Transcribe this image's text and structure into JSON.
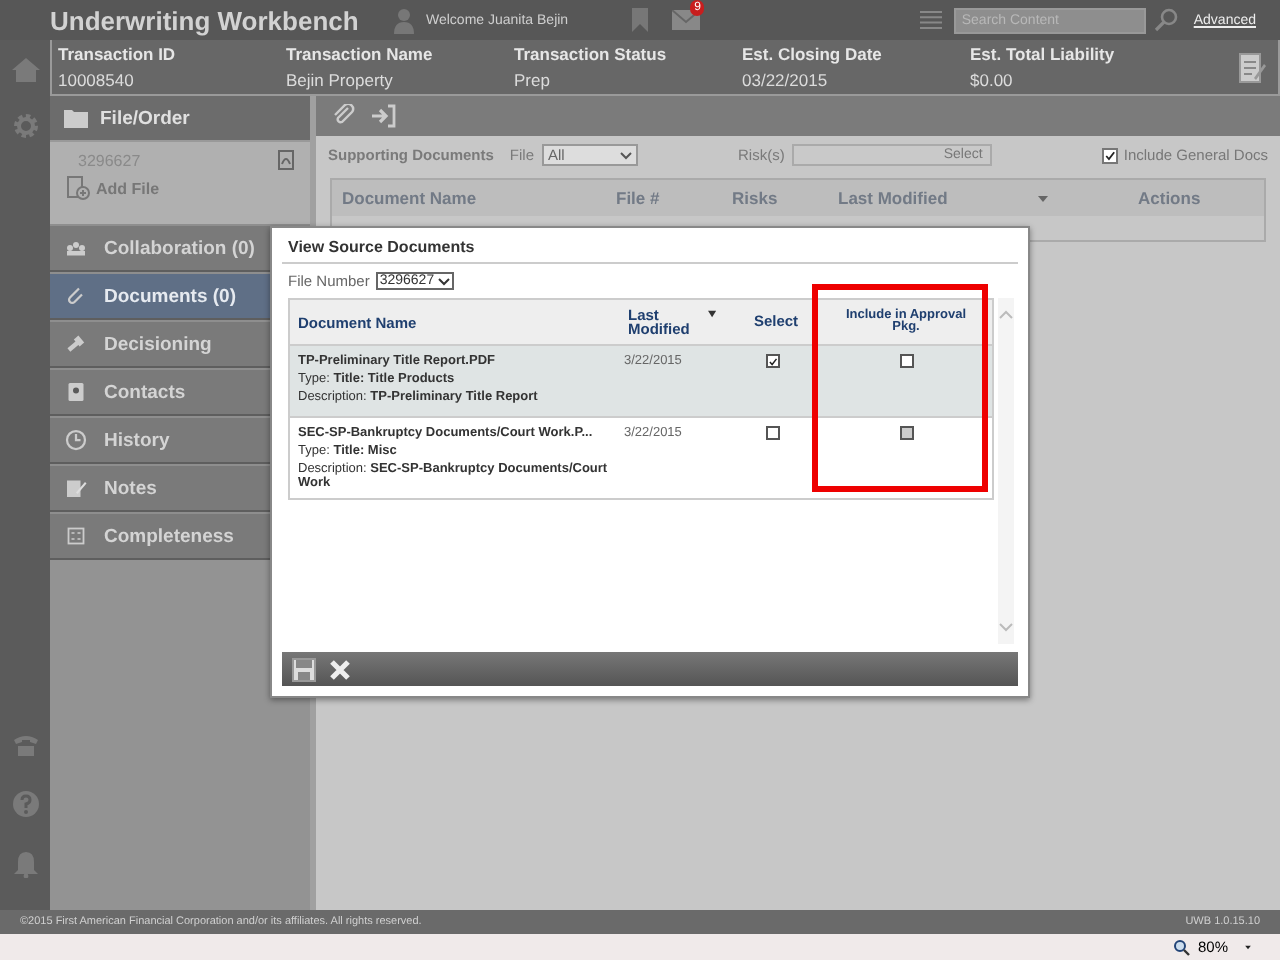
{
  "header": {
    "title": "Underwriting Workbench",
    "welcome": "Welcome Juanita Bejin",
    "mail_badge": "9",
    "search_placeholder": "Search Content",
    "advanced_link": "Advanced"
  },
  "transaction": [
    {
      "label": "Transaction ID",
      "value": "10008540"
    },
    {
      "label": "Transaction Name",
      "value": "Bejin Property"
    },
    {
      "label": "Transaction Status",
      "value": "Prep"
    },
    {
      "label": "Est. Closing Date",
      "value": "03/22/2015"
    },
    {
      "label": "Est. Total Liability",
      "value": "$0.00"
    }
  ],
  "sidebar": {
    "section_title": "File/Order",
    "file_number": "3296627",
    "add_file": "Add File",
    "items": [
      {
        "label": "Collaboration (0)",
        "selected": false
      },
      {
        "label": "Documents (0)",
        "selected": true
      },
      {
        "label": "Decisioning",
        "selected": false
      },
      {
        "label": "Contacts",
        "selected": false
      },
      {
        "label": "History",
        "selected": false
      },
      {
        "label": "Notes",
        "selected": false
      },
      {
        "label": "Completeness",
        "selected": false
      }
    ]
  },
  "main": {
    "title": "Supporting Documents",
    "file_label": "File",
    "file_value": "All",
    "risks_label": "Risk(s)",
    "risks_placeholder": "Select",
    "include_general_docs": {
      "label": "Include General Docs",
      "checked": true
    },
    "columns": [
      "Document Name",
      "File #",
      "Risks",
      "Last Modified",
      "Actions"
    ]
  },
  "modal": {
    "title": "View Source Documents",
    "file_number_label": "File Number",
    "file_number_value": "3296627",
    "columns": [
      "Document Name",
      "Last Modified",
      "Select",
      "Include in Approval Pkg."
    ],
    "rows": [
      {
        "name": "TP-Preliminary Title Report.PDF",
        "type_label": "Type:",
        "type_value": "Title: Title Products",
        "description_label": "Description:",
        "description_value": "TP-Preliminary Title Report",
        "last_modified": "3/22/2015",
        "selected": true,
        "include": false
      },
      {
        "name": "SEC-SP-Bankruptcy Documents/Court Work.P...",
        "type_label": "Type:",
        "type_value": "Title: Misc",
        "description_label": "Description:",
        "description_value": "SEC-SP-Bankruptcy Documents/Court Work",
        "last_modified": "3/22/2015",
        "selected": false,
        "include": false
      }
    ]
  },
  "footer": {
    "copyright": "©2015 First American Financial Corporation and/or its affiliates. All rights reserved.",
    "version": "UWB 1.0.15.10"
  },
  "status_bar": {
    "zoom": "80%"
  }
}
